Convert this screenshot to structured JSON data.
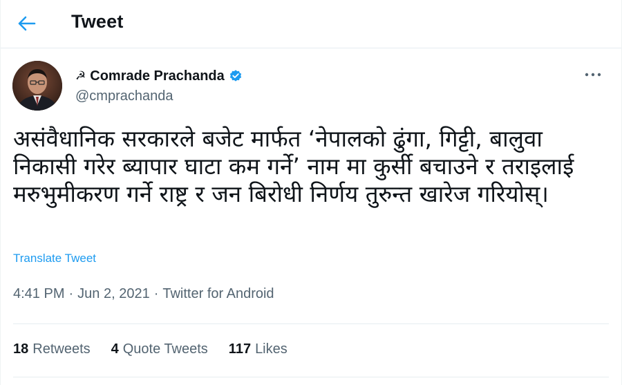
{
  "header": {
    "title": "Tweet",
    "back_icon": "arrow-left-icon",
    "accent_color": "#1d9bf0"
  },
  "author": {
    "symbol": "☭",
    "display_name": "Comrade Prachanda",
    "handle": "@cmprachanda",
    "verified": true,
    "verified_icon": "verified-badge-icon"
  },
  "tweet": {
    "text": "असंवैधानिक सरकारले बजेट मार्फत ‘नेपालको ढुंगा, गिट्टी, बालुवा निकासी गरेर ब्यापार घाटा कम गर्ने’ नाम मा कुर्सी बचाउने र तराइलाई मरुभुमीकरण गर्ने राष्ट्र र जन बिरोधी निर्णय तुरुन्त खारेज गरियोस्।",
    "translate_label": "Translate Tweet",
    "time": "4:41 PM",
    "date": "Jun 2, 2021",
    "source": "Twitter for Android",
    "separator": "·"
  },
  "stats": {
    "retweets_count": "18",
    "retweets_label": "Retweets",
    "quotes_count": "4",
    "quotes_label": "Quote Tweets",
    "likes_count": "117",
    "likes_label": "Likes"
  }
}
